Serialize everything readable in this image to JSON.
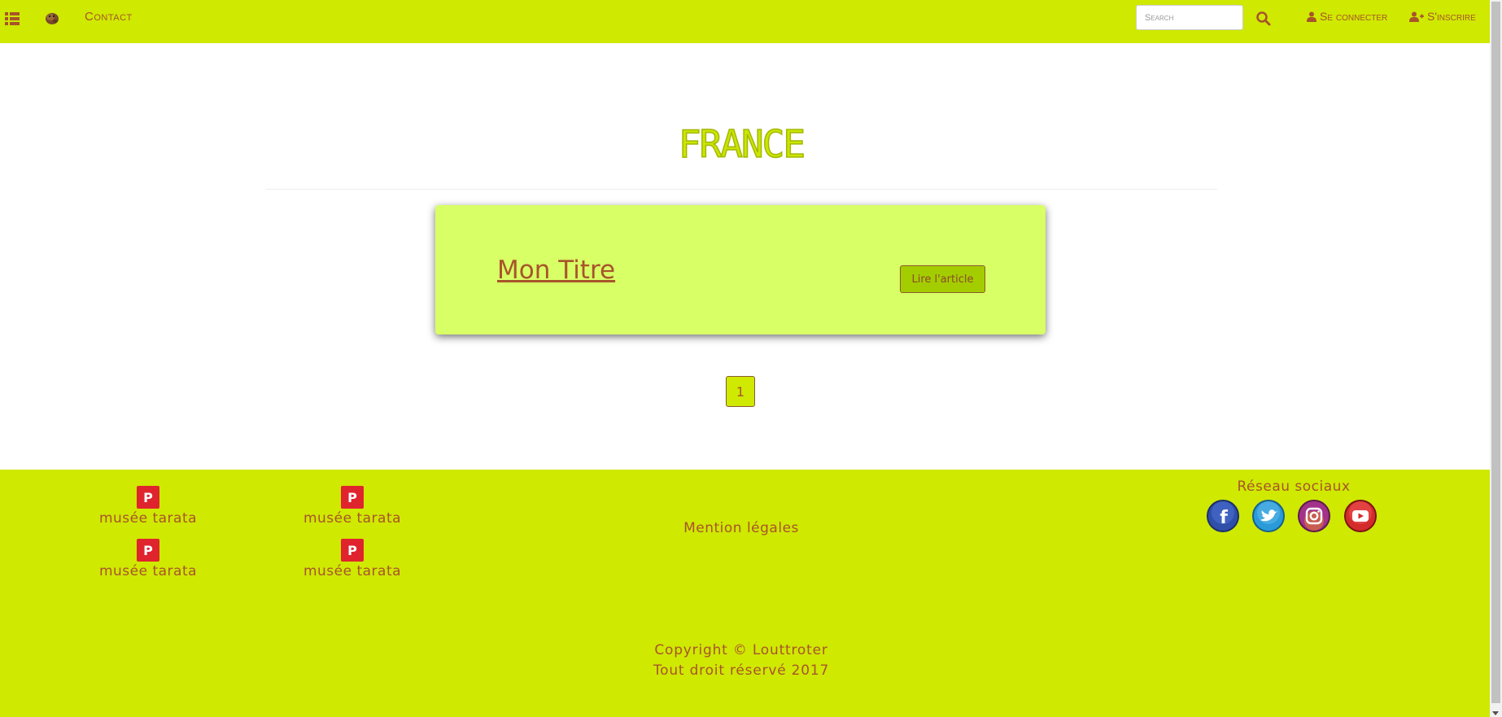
{
  "nav": {
    "menu_icon": "list-icon",
    "logo_icon": "otter-logo-icon",
    "contact_label": "Contact",
    "search_placeholder": "Search",
    "search_icon": "search-icon",
    "login_label": "Se connecter",
    "register_label": "S'inscrire"
  },
  "main": {
    "title": "France",
    "article": {
      "title": "Mon Titre",
      "read_label": "Lire l'article"
    },
    "pagination": {
      "current": "1"
    }
  },
  "footer": {
    "pinterest_links": [
      {
        "label": "musée tarata"
      },
      {
        "label": "musée tarata"
      },
      {
        "label": "musée tarata"
      },
      {
        "label": "musée tarata"
      }
    ],
    "legal_label": "Mention légales",
    "social_title": "Réseau sociaux",
    "social_icons": [
      "facebook-icon",
      "twitter-icon",
      "instagram-icon",
      "youtube-icon"
    ],
    "copyright_line1": "Copyright © Louttroter",
    "copyright_line2": "Tout droit réservé 2017"
  },
  "colors": {
    "brand_lime": "#cfe900",
    "card_bg": "#d8ff66",
    "text_brown": "#a8542b",
    "pinterest_red": "#e0242e"
  }
}
